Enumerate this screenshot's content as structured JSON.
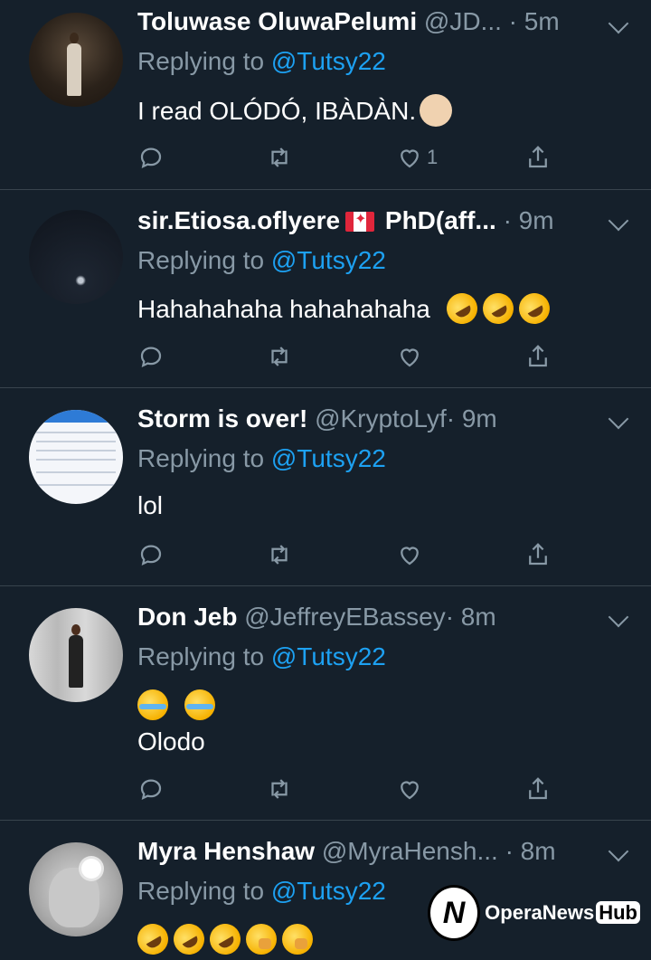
{
  "tweets": [
    {
      "name": "Toluwase OluwaPelumi",
      "handle": "@JD...",
      "time": "· 5m",
      "replying_prefix": "Replying to ",
      "replying_to": "@Tutsy22",
      "text": "I read OLÓDÓ, IBÀDÀN.",
      "emoji": [
        "person-shrugging"
      ],
      "like_count": "1"
    },
    {
      "name": "sir.Etiosa.oflyere",
      "name_suffix": "PhD(aff...",
      "flag": "canada-flag",
      "time": "· 9m",
      "replying_prefix": "Replying to ",
      "replying_to": "@Tutsy22",
      "text": "Hahahahaha hahahahaha",
      "emoji": [
        "rolling-on-floor-laughing",
        "rolling-on-floor-laughing",
        "rolling-on-floor-laughing"
      ],
      "like_count": ""
    },
    {
      "name": "Storm is over!",
      "handle": "@KryptoLyf",
      "time": "· 9m",
      "replying_prefix": "Replying to ",
      "replying_to": "@Tutsy22",
      "text": "lol",
      "like_count": ""
    },
    {
      "name": "Don Jeb",
      "handle": "@JeffreyEBassey",
      "time": "· 8m",
      "replying_prefix": "Replying to ",
      "replying_to": "@Tutsy22",
      "emoji": [
        "face-with-tears-of-joy",
        "face-with-tears-of-joy"
      ],
      "text": "Olodo",
      "like_count": ""
    },
    {
      "name": "Myra Henshaw",
      "handle": "@MyraHensh...",
      "time": "· 8m",
      "replying_prefix": "Replying to ",
      "replying_to": "@Tutsy22",
      "emoji": [
        "rolling-on-floor-laughing",
        "rolling-on-floor-laughing",
        "rolling-on-floor-laughing",
        "face-with-hand-over-mouth",
        "face-with-hand-over-mouth"
      ]
    }
  ],
  "watermark": {
    "brand": "OperaNews",
    "hub": "Hub"
  },
  "colors": {
    "background": "#15202b",
    "muted": "#8899a6",
    "link": "#1da1f2",
    "divider": "#38444d"
  }
}
